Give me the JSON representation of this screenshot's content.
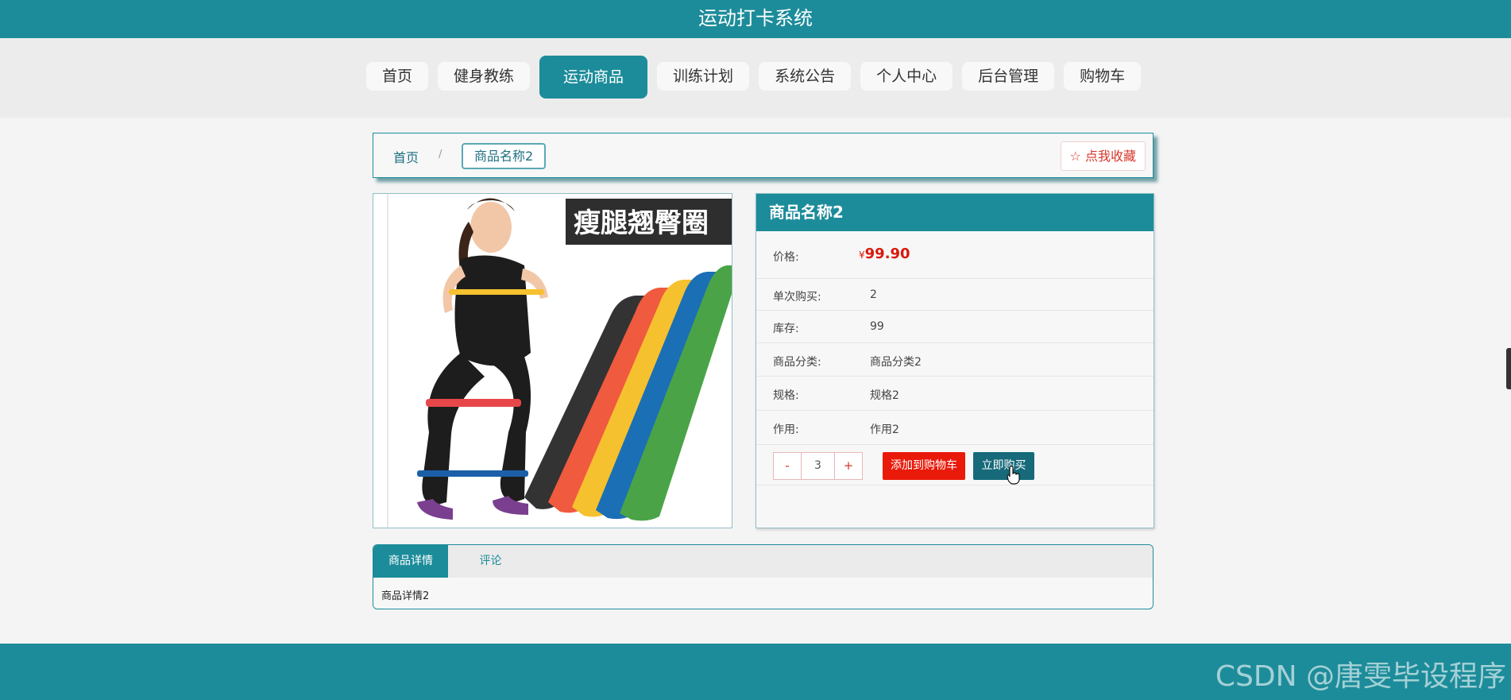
{
  "app": {
    "title": "运动打卡系统"
  },
  "nav": {
    "items": [
      {
        "label": "首页"
      },
      {
        "label": "健身教练"
      },
      {
        "label": "运动商品"
      },
      {
        "label": "训练计划"
      },
      {
        "label": "系统公告"
      },
      {
        "label": "个人中心"
      },
      {
        "label": "后台管理"
      },
      {
        "label": "购物车"
      }
    ],
    "active": "运动商品"
  },
  "breadcrumb": {
    "home": "首页",
    "separator": "/",
    "current": "商品名称2"
  },
  "favorite_button": {
    "icon": "star-outline-icon",
    "label": "点我收藏"
  },
  "product_image": {
    "banner_text": "瘦腿翘臀圈"
  },
  "product": {
    "name": "商品名称2",
    "price_label": "价格:",
    "currency": "¥",
    "price": "99.90",
    "fields": [
      {
        "label": "单次购买:",
        "value": "2"
      },
      {
        "label": "库存:",
        "value": "99"
      },
      {
        "label": "商品分类:",
        "value": "商品分类2"
      },
      {
        "label": "规格:",
        "value": "规格2"
      },
      {
        "label": "作用:",
        "value": "作用2"
      }
    ]
  },
  "quantity": {
    "minus": "-",
    "value": "3",
    "plus": "+"
  },
  "actions": {
    "add_to_cart": "添加到购物车",
    "buy_now": "立即购买"
  },
  "tabs": {
    "items": [
      {
        "label": "商品详情"
      },
      {
        "label": "评论"
      }
    ],
    "active": "商品详情",
    "content": "商品详情2"
  },
  "watermark": "CSDN @唐雯毕设程序",
  "colors": {
    "primary": "#1d8c9a",
    "danger": "#ea1a0a",
    "buy": "#166a7a",
    "price": "#d9180c"
  }
}
